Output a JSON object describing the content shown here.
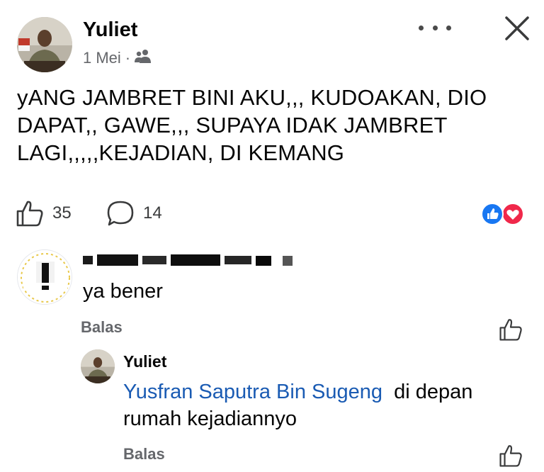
{
  "post": {
    "author": "Yuliet",
    "date": "1 Mei",
    "separator": "·",
    "privacy_icon": "friends-icon",
    "text": "yANG JAMBRET BINI AKU,,, KUDOAKAN, DIO DAPAT,, GAWE,,, SUPAYA IDAK JAMBRET LAGI,,,,,KEJADIAN, DI KEMANG",
    "like_count": "35",
    "comment_count": "14",
    "reaction_icons": [
      "like-reaction-icon",
      "love-reaction-icon"
    ]
  },
  "comments": [
    {
      "author_redacted": true,
      "text": "ya bener",
      "reply_label": "Balas"
    },
    {
      "author": "Yuliet",
      "mention": "Yusfran Saputra Bin Sugeng",
      "text": "di depan rumah kejadiannyo",
      "reply_label": "Balas"
    }
  ],
  "colors": {
    "text": "#050505",
    "secondary": "#65676b",
    "mention": "#1a5bb3",
    "like_blue": "#1877f2",
    "love_red": "#f0284a"
  }
}
